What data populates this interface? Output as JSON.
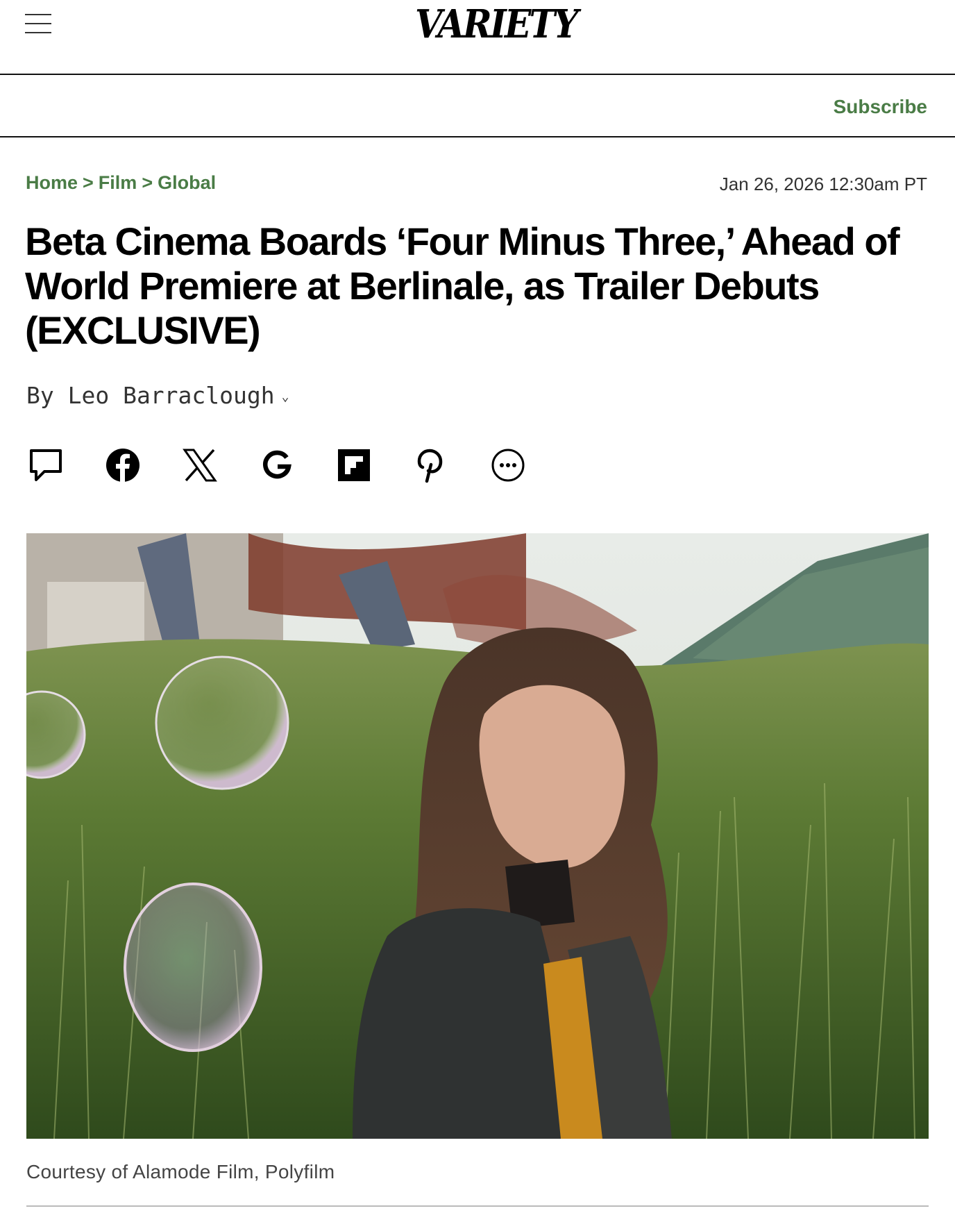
{
  "header": {
    "logo": "VARIETY",
    "menu_icon": "hamburger-menu-icon",
    "subscribe_label": "Subscribe"
  },
  "breadcrumb": [
    {
      "label": "Home"
    },
    {
      "label": "Film"
    },
    {
      "label": "Global"
    }
  ],
  "breadcrumb_separator": ">",
  "article": {
    "date": "Jan 26, 2026 12:30am PT",
    "headline": "Beta Cinema Boards ‘Four Minus Three,’ Ahead of World Premiere at Berlinale, as Trailer Debuts (EXCLUSIVE)",
    "byline": "By Leo Barraclough",
    "image_caption": "Courtesy of Alamode Film, Polyfilm"
  },
  "share_icons": [
    "comment-icon",
    "facebook-icon",
    "x-twitter-icon",
    "google-icon",
    "flipboard-icon",
    "pinterest-icon",
    "more-options-icon"
  ],
  "colors": {
    "accent_green": "#4a7c46",
    "text": "#000000",
    "muted_text": "#444444"
  }
}
